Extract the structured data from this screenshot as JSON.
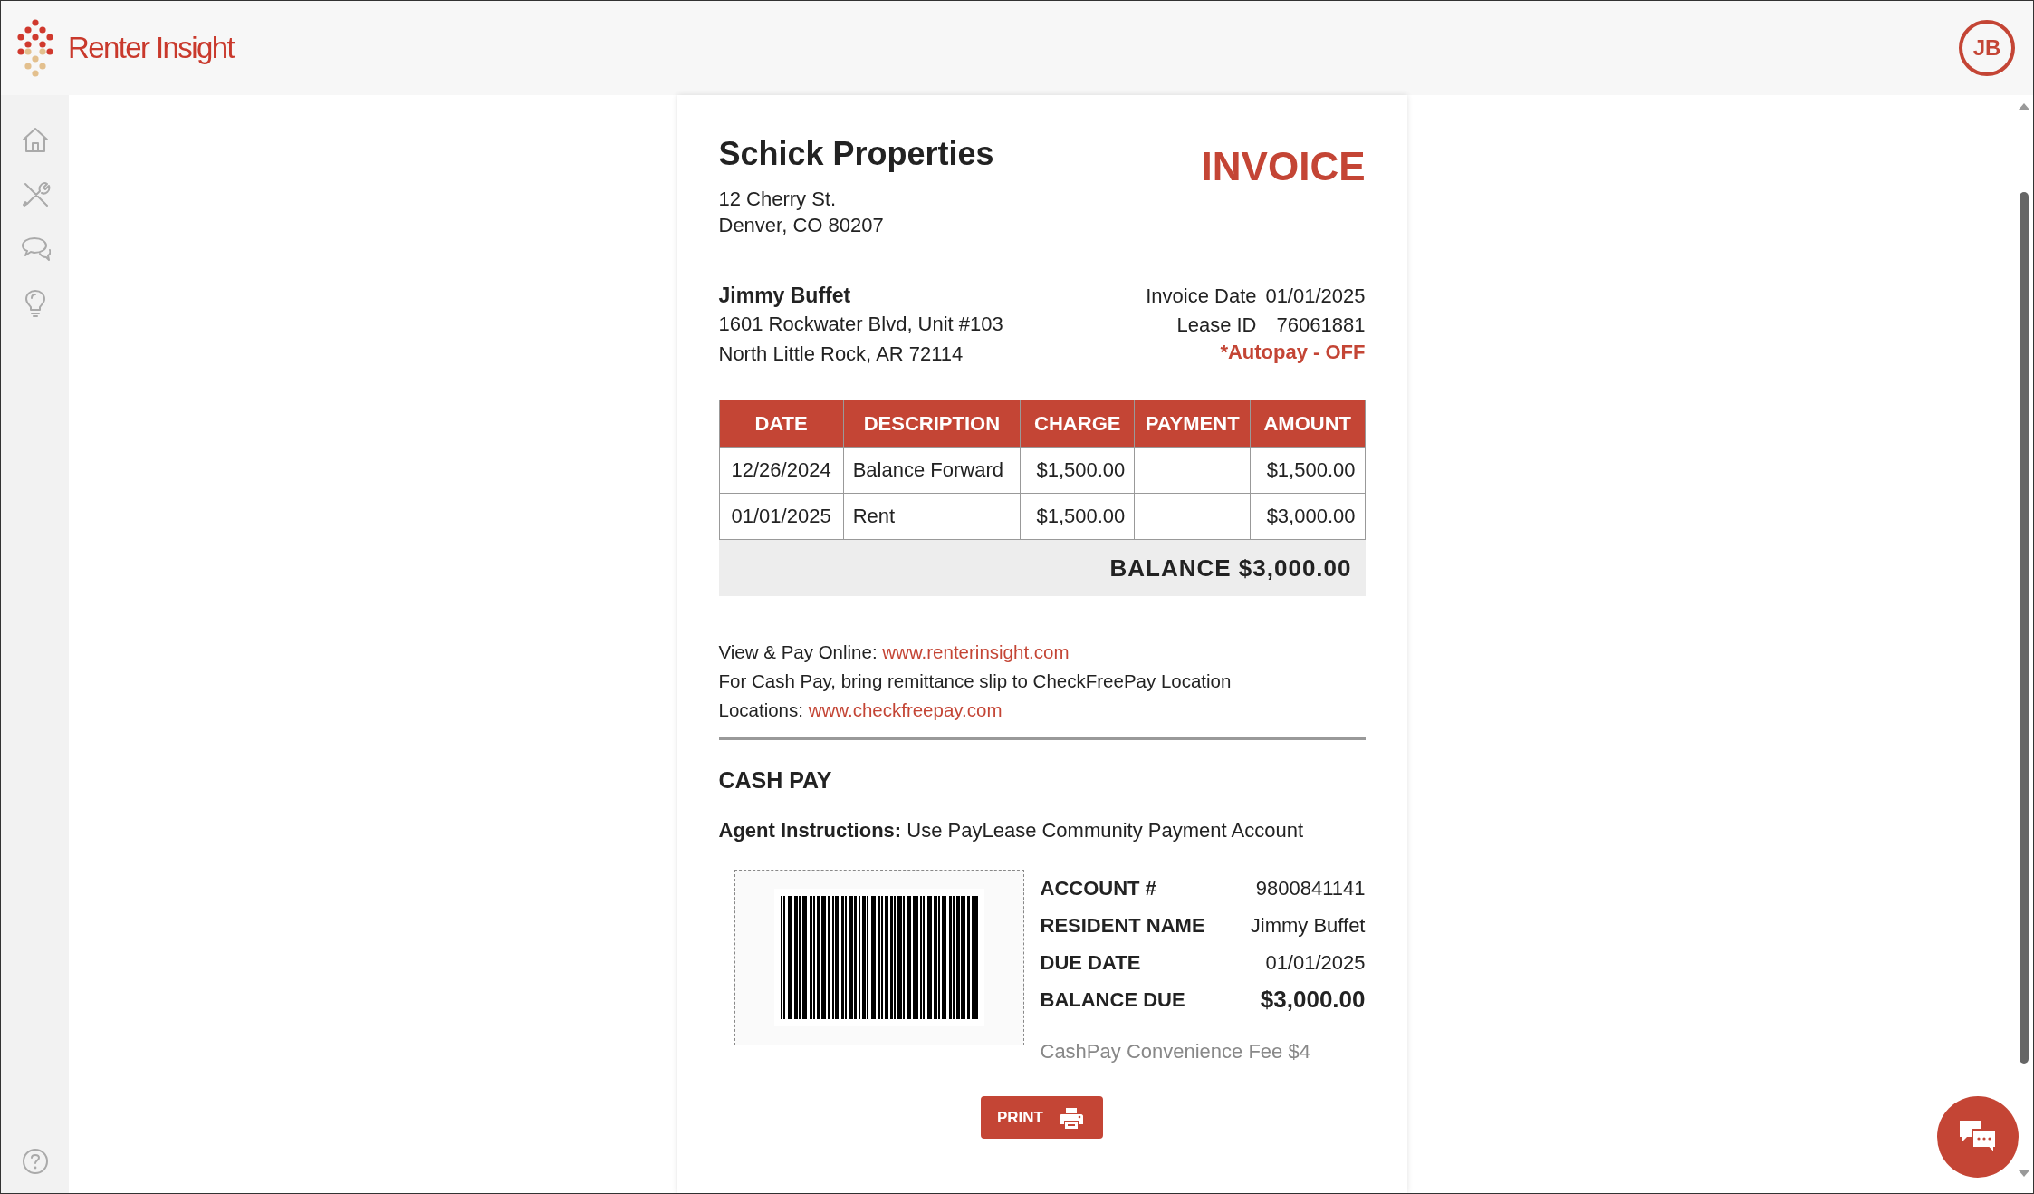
{
  "header": {
    "logo": "Renter Insight",
    "avatar": "JB"
  },
  "invoice": {
    "company": "Schick Properties",
    "company_address": [
      "12 Cherry St.",
      "Denver, CO 80207"
    ],
    "title": "INVOICE",
    "tenant": {
      "name": "Jimmy Buffet",
      "address": [
        "1601 Rockwater Blvd, Unit #103",
        "North Little Rock, AR 72114"
      ]
    },
    "meta": [
      {
        "label": "Invoice Date",
        "value": "01/01/2025"
      },
      {
        "label": "Lease ID",
        "value": "76061881"
      }
    ],
    "autopay": "*Autopay - OFF",
    "table": {
      "columns": [
        "DATE",
        "DESCRIPTION",
        "CHARGE",
        "PAYMENT",
        "AMOUNT"
      ],
      "rows": [
        [
          "12/26/2024",
          "Balance Forward",
          "$1,500.00",
          "",
          "$1,500.00"
        ],
        [
          "01/01/2025",
          "Rent",
          "$1,500.00",
          "",
          "$3,000.00"
        ]
      ],
      "balance": "BALANCE $3,000.00"
    },
    "notes": [
      {
        "text": "View & Pay Online: ",
        "link": "www.renterinsight.com"
      },
      {
        "text": "For Cash Pay, bring remittance slip to CheckFreePay Location"
      },
      {
        "text": "Locations: ",
        "link": "www.checkfreepay.com"
      }
    ],
    "cash_pay": {
      "title": "CASH PAY",
      "agent": "**Agent Instructions:** Use PayLease Community Payment Account",
      "details": [
        {
          "label": "ACCOUNT #",
          "value": "9800841141"
        },
        {
          "label": "RESIDENT NAME",
          "value": "Jimmy Buffet"
        },
        {
          "label": "DUE DATE",
          "value": "01/01/2025"
        },
        {
          "label": "BALANCE DUE",
          "value": "$3,000.00",
          "emphasis": true
        }
      ],
      "fee": "CashPay Convenience Fee $4",
      "print": "PRINT"
    }
  }
}
